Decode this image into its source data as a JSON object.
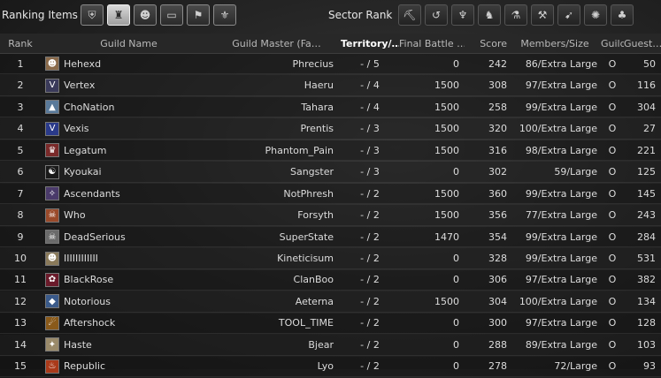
{
  "toolbar": {
    "ranking_items_label": "Ranking Items",
    "sector_rank_label": "Sector Rank",
    "ranking_icons": [
      {
        "name": "shield-icon",
        "glyph": "⛨",
        "active": false
      },
      {
        "name": "robe-icon",
        "glyph": "♜",
        "active": true
      },
      {
        "name": "group-icon",
        "glyph": "☻",
        "active": false
      },
      {
        "name": "scroll-icon",
        "glyph": "▭",
        "active": false
      },
      {
        "name": "banner-icon",
        "glyph": "⚑",
        "active": false
      },
      {
        "name": "crest-icon",
        "glyph": "⚜",
        "active": false
      }
    ],
    "sector_icons": [
      {
        "name": "pickaxe-icon",
        "glyph": "⛏"
      },
      {
        "name": "fishing-icon",
        "glyph": "↺"
      },
      {
        "name": "antler-icon",
        "glyph": "♆"
      },
      {
        "name": "horse-icon",
        "glyph": "♞"
      },
      {
        "name": "flask-icon",
        "glyph": "⚗"
      },
      {
        "name": "hammer-icon",
        "glyph": "⚒"
      },
      {
        "name": "arrow-icon",
        "glyph": "➹"
      },
      {
        "name": "wheel-icon",
        "glyph": "✺"
      },
      {
        "name": "sprout-icon",
        "glyph": "♣"
      }
    ]
  },
  "columns": {
    "rank": "Rank",
    "guild_name": "Guild Name",
    "guild_master": "Guild Master (Fa…",
    "territory": "Territory/…",
    "final_battle": "Final Battle …",
    "score": "Score",
    "members": "Members/Size",
    "guild_i": "Guild I…",
    "guest": "Guest…"
  },
  "rows": [
    {
      "rank": "1",
      "guild": "Hehexd",
      "master": "Phrecius",
      "territory": "- / 5",
      "final": "0",
      "score": "242",
      "members": "86/Extra Large",
      "gi": "O",
      "guest": "50",
      "emblem_color": "#8a6a4a",
      "emblem_glyph": "☻"
    },
    {
      "rank": "2",
      "guild": "Vertex",
      "master": "Haeru",
      "territory": "- / 4",
      "final": "1500",
      "score": "308",
      "members": "97/Extra Large",
      "gi": "O",
      "guest": "116",
      "emblem_color": "#3a3a5a",
      "emblem_glyph": "V"
    },
    {
      "rank": "3",
      "guild": "ChoNation",
      "master": "Tahara",
      "territory": "- / 4",
      "final": "1500",
      "score": "258",
      "members": "99/Extra Large",
      "gi": "O",
      "guest": "304",
      "emblem_color": "#5a7a9a",
      "emblem_glyph": "▲"
    },
    {
      "rank": "4",
      "guild": "Vexis",
      "master": "Prentis",
      "territory": "- / 3",
      "final": "1500",
      "score": "320",
      "members": "100/Extra Large",
      "gi": "O",
      "guest": "27",
      "emblem_color": "#2a3a8a",
      "emblem_glyph": "V"
    },
    {
      "rank": "5",
      "guild": "Legatum",
      "master": "Phantom_Pain",
      "territory": "- / 3",
      "final": "1500",
      "score": "316",
      "members": "98/Extra Large",
      "gi": "O",
      "guest": "221",
      "emblem_color": "#7a2a2a",
      "emblem_glyph": "♛"
    },
    {
      "rank": "6",
      "guild": "Kyoukai",
      "master": "Sangster",
      "territory": "- / 3",
      "final": "0",
      "score": "302",
      "members": "59/Large",
      "gi": "O",
      "guest": "125",
      "emblem_color": "#1a1a1a",
      "emblem_glyph": "☯"
    },
    {
      "rank": "7",
      "guild": "Ascendants",
      "master": "NotPhresh",
      "territory": "- / 2",
      "final": "1500",
      "score": "360",
      "members": "99/Extra Large",
      "gi": "O",
      "guest": "145",
      "emblem_color": "#4a3a6a",
      "emblem_glyph": "✧"
    },
    {
      "rank": "8",
      "guild": "Who",
      "master": "Forsyth",
      "territory": "- / 2",
      "final": "1500",
      "score": "356",
      "members": "77/Extra Large",
      "gi": "O",
      "guest": "243",
      "emblem_color": "#9a4a2a",
      "emblem_glyph": "☠"
    },
    {
      "rank": "9",
      "guild": "DeadSerious",
      "master": "SuperState",
      "territory": "- / 2",
      "final": "1470",
      "score": "354",
      "members": "99/Extra Large",
      "gi": "O",
      "guest": "284",
      "emblem_color": "#6a6a6a",
      "emblem_glyph": "☠"
    },
    {
      "rank": "10",
      "guild": "IIIIIIIIIIII",
      "master": "Kineticisum",
      "territory": "- / 2",
      "final": "0",
      "score": "328",
      "members": "99/Extra Large",
      "gi": "O",
      "guest": "531",
      "emblem_color": "#8a7a5a",
      "emblem_glyph": "☻"
    },
    {
      "rank": "11",
      "guild": "BlackRose",
      "master": "ClanBoo",
      "territory": "- / 2",
      "final": "0",
      "score": "306",
      "members": "97/Extra Large",
      "gi": "O",
      "guest": "382",
      "emblem_color": "#6a1a2a",
      "emblem_glyph": "✿"
    },
    {
      "rank": "12",
      "guild": "Notorious",
      "master": "Aeterna",
      "territory": "- / 2",
      "final": "1500",
      "score": "304",
      "members": "100/Extra Large",
      "gi": "O",
      "guest": "134",
      "emblem_color": "#3a5a8a",
      "emblem_glyph": "◆"
    },
    {
      "rank": "13",
      "guild": "Aftershock",
      "master": "TOOL_TIME",
      "territory": "- / 2",
      "final": "0",
      "score": "300",
      "members": "97/Extra Large",
      "gi": "O",
      "guest": "128",
      "emblem_color": "#8a5a1a",
      "emblem_glyph": "☄"
    },
    {
      "rank": "14",
      "guild": "Haste",
      "master": "Bjear",
      "territory": "- / 2",
      "final": "0",
      "score": "288",
      "members": "89/Extra Large",
      "gi": "O",
      "guest": "103",
      "emblem_color": "#9a8a6a",
      "emblem_glyph": "✦"
    },
    {
      "rank": "15",
      "guild": "Republic",
      "master": "Lyo",
      "territory": "- / 2",
      "final": "0",
      "score": "278",
      "members": "72/Large",
      "gi": "O",
      "guest": "93",
      "emblem_color": "#aa3a1a",
      "emblem_glyph": "♨"
    }
  ]
}
